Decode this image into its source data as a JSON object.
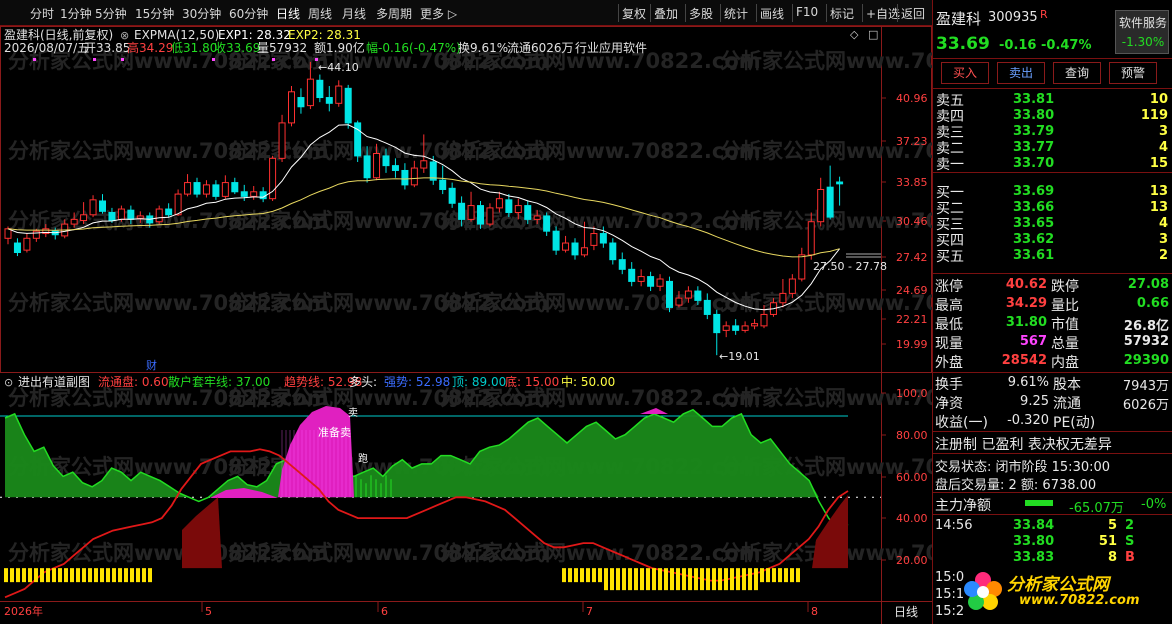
{
  "period_bar": {
    "left": [
      "分时",
      "1分钟",
      "5分钟",
      "15分钟",
      "30分钟",
      "60分钟",
      "日线",
      "周线",
      "月线",
      "多周期",
      "更多"
    ],
    "right": [
      "复权",
      "叠加",
      "多股",
      "统计",
      "画线",
      "F10",
      "标记",
      "+自选",
      "返回"
    ]
  },
  "chart_header": {
    "stock": "盈建科(日线,前复权)",
    "indicator": "EXPMA(12,50)",
    "exp1": "EXP1: 28.32",
    "exp2": "EXP2: 28.31"
  },
  "bar_info": {
    "date": "2026/08/07/五",
    "open": "开33.85",
    "high": "高34.29",
    "low": "低31.80",
    "close": "收33.69",
    "volume": "量57932",
    "amount": "额1.90亿",
    "change": "幅-0.16(-0.47%)",
    "turnover": "换9.61%",
    "float_cap": "流通6026万",
    "industry": "行业应用软件"
  },
  "price_axis": [
    "40.96",
    "37.23",
    "33.85",
    "30.46",
    "27.42",
    "24.69",
    "22.21",
    "19.99"
  ],
  "annotations": {
    "high_mark": "44.10",
    "low_mark": "19.01",
    "range_label": "27.50 - 27.78",
    "cai_badge": "财"
  },
  "sub_header": {
    "name": "进出有道副图",
    "items": [
      {
        "text": "流通盘: 0.60",
        "color": "#ff4040"
      },
      {
        "text": "散户套牢线: 37.00",
        "color": "#22dd22"
      },
      {
        "text": "趋势线: 52.98",
        "color": "#ff4040"
      },
      {
        "text": "多头:",
        "color": "#e8e8e8"
      },
      {
        "text": "强势: 52.98",
        "color": "#3b6cff"
      },
      {
        "text": "顶: 89.00",
        "color": "#00cccc"
      },
      {
        "text": "底: 15.00",
        "color": "#ff4040"
      },
      {
        "text": "中: 50.00",
        "color": "#ffff44"
      }
    ]
  },
  "sub_axis": [
    "100.0",
    "80.00",
    "60.00",
    "40.00",
    "20.00"
  ],
  "sub_labels": {
    "zhunbei": "准备卖",
    "mai": "卖",
    "pao": "跑"
  },
  "date_axis": {
    "year": "2026年",
    "months": [
      "5",
      "6",
      "7",
      "8"
    ],
    "period": "日线"
  },
  "watermark": "分析家公式网www.70822.com",
  "chart_data": {
    "type": "candlestick",
    "ylim": [
      19.0,
      44.5
    ],
    "series": [
      {
        "name": "EXP1",
        "values": [
          28.32
        ]
      },
      {
        "name": "EXP2",
        "values": [
          28.31
        ]
      }
    ]
  },
  "quote": {
    "name": "盈建科",
    "code": "300935",
    "r_badge": "R",
    "service": "软件服务",
    "service_pct": "-1.30%",
    "price": "33.69",
    "change": "-0.16",
    "change_pct": "-0.47%",
    "buttons": [
      "买入",
      "卖出",
      "查询",
      "预警"
    ]
  },
  "order_book": {
    "asks": [
      {
        "label": "卖五",
        "price": "33.81",
        "vol": "10"
      },
      {
        "label": "卖四",
        "price": "33.80",
        "vol": "119"
      },
      {
        "label": "卖三",
        "price": "33.79",
        "vol": "3"
      },
      {
        "label": "卖二",
        "price": "33.77",
        "vol": "4"
      },
      {
        "label": "卖一",
        "price": "33.70",
        "vol": "15"
      }
    ],
    "bids": [
      {
        "label": "买一",
        "price": "33.69",
        "vol": "13"
      },
      {
        "label": "买二",
        "price": "33.66",
        "vol": "13"
      },
      {
        "label": "买三",
        "price": "33.65",
        "vol": "4"
      },
      {
        "label": "买四",
        "price": "33.62",
        "vol": "3"
      },
      {
        "label": "买五",
        "price": "33.61",
        "vol": "2"
      }
    ]
  },
  "stats": [
    {
      "k1": "涨停",
      "v1": "40.62",
      "c1": "#ff4040",
      "k2": "跌停",
      "v2": "27.08",
      "c2": "#22dd22"
    },
    {
      "k1": "最高",
      "v1": "34.29",
      "c1": "#ff4040",
      "k2": "量比",
      "v2": "0.66",
      "c2": "#22dd22"
    },
    {
      "k1": "最低",
      "v1": "31.80",
      "c1": "#22dd22",
      "k2": "市值",
      "v2": "26.8亿",
      "c2": "#e8e8e8"
    },
    {
      "k1": "现量",
      "v1": "567",
      "c1": "#ff44ff",
      "k2": "总量",
      "v2": "57932",
      "c2": "#e8e8e8"
    },
    {
      "k1": "外盘",
      "v1": "28542",
      "c1": "#ff4040",
      "k2": "内盘",
      "v2": "29390",
      "c2": "#22dd22"
    }
  ],
  "stats2": [
    {
      "k1": "换手",
      "v1": "9.61%",
      "k2": "股本",
      "v2": "7943万"
    },
    {
      "k1": "净资",
      "v1": "9.25",
      "k2": "流通",
      "v2": "6026万"
    },
    {
      "k1": "收益(一)",
      "v1": "-0.320",
      "k2": "PE(动)",
      "v2": ""
    }
  ],
  "reg": "注册制 已盈利 表决权无差异",
  "trade_status": "交易状态: 闭市阶段 15:30:00",
  "after_hours": "盘后交易量: 2  额: 6738.00",
  "main_net": {
    "label": "主力净额",
    "value": "-65.07万",
    "pct": "-0%"
  },
  "ticks": [
    {
      "time": "14:56",
      "price": "33.84",
      "vol": "5",
      "flag": "2"
    },
    {
      "time": "",
      "price": "33.80",
      "vol": "51",
      "flag": "S"
    },
    {
      "time": "",
      "price": "33.83",
      "vol": "8",
      "flag": "B"
    }
  ],
  "tick_times": [
    "15:0",
    "15:1",
    "15:2"
  ],
  "logo": {
    "text": "分析家公式网",
    "url": "www.70822.com"
  }
}
